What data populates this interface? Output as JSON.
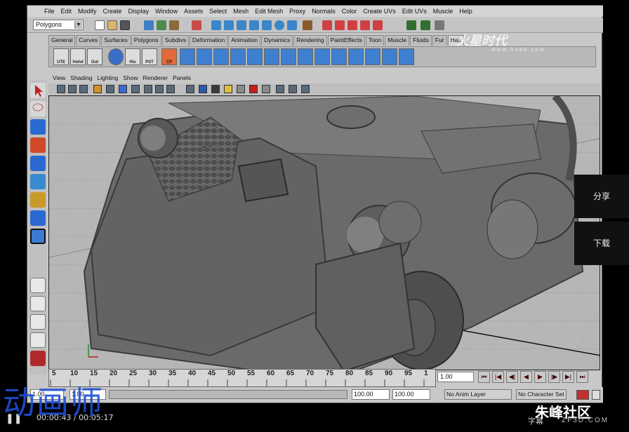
{
  "menubar": [
    "File",
    "Edit",
    "Modify",
    "Create",
    "Display",
    "Window",
    "Assets",
    "Select",
    "Mesh",
    "Edit Mesh",
    "Proxy",
    "Normals",
    "Color",
    "Create UVs",
    "Edit UVs",
    "Muscle",
    "Help"
  ],
  "statusline": {
    "mode": "Polygons"
  },
  "shelf_tabs": [
    "General",
    "Curves",
    "Surfaces",
    "Polygons",
    "Subdivs",
    "Deformation",
    "Animation",
    "Dynamics",
    "Rendering",
    "PaintEffects",
    "Toon",
    "Muscle",
    "Fluids",
    "Fur",
    "Hair"
  ],
  "shelf_labels": [
    "UTE",
    "Hshd",
    "Out",
    "His",
    "PST",
    "CP"
  ],
  "panel_menu": [
    "View",
    "Shading",
    "Lighting",
    "Show",
    "Renderer",
    "Panels"
  ],
  "timeslider": {
    "ticks": [
      "5",
      "10",
      "15",
      "20",
      "25",
      "30",
      "35",
      "40",
      "45",
      "50",
      "55",
      "60",
      "65",
      "70",
      "75",
      "80",
      "85",
      "90",
      "95",
      "1"
    ]
  },
  "current_frame": "1.00",
  "range": {
    "start": "1.00",
    "start2": "1.00",
    "end": "100.00",
    "end2": "100.00",
    "anim_layer": "No Anim Layer",
    "char_set": "No Character Set"
  },
  "side_buttons": {
    "share": "分享",
    "download": "下载"
  },
  "player": {
    "time": "00:00:43 / 00:05:17"
  },
  "overlay": {
    "channel_logo": "动画师",
    "site_logo": "朱峰社区",
    "site_sub": "ZF3D.COM",
    "caption": "字幕",
    "watermark": "火星时代",
    "watermark_sub": "www.hxsd.com"
  },
  "colors": {
    "maya_bg": "#c8c8c8",
    "viewport_bg": "#b4b4b4",
    "mesh": "#6a6a6a",
    "channel_blue": "#1f4fd8"
  }
}
